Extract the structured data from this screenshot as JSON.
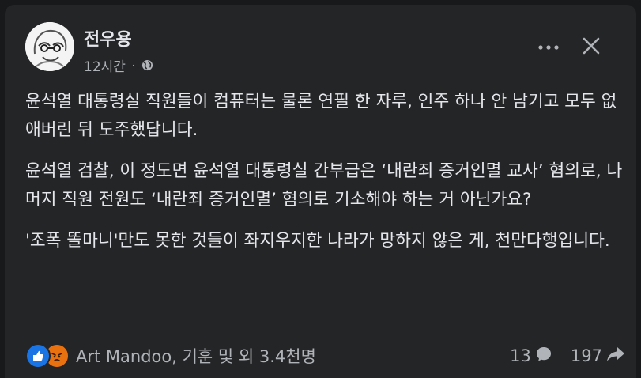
{
  "post": {
    "author": "전우용",
    "time": "12시간",
    "separator": "·",
    "paragraphs": [
      "윤석열 대통령실 직원들이 컴퓨터는 물론 연필 한 자루, 인주 하나 안 남기고 모두 없애버린 뒤 도주했답니다.",
      "윤석열 검찰, 이 정도면 윤석열 대통령실 간부급은 ‘내란죄 증거인멸 교사’ 혐의로, 나머지 직원 전원도 ‘내란죄 증거인멸’ 혐의로 기소해야 하는 거 아닌가요?",
      "'조폭 똘마니'만도 못한 것들이 좌지우지한 나라가 망하지 않은 게, 천만다행입니다."
    ]
  },
  "footer": {
    "reactors": "Art Mandoo, 기훈 및 외 3.4천명",
    "comments": "13",
    "shares": "197"
  },
  "icons": [
    "globe-icon",
    "more-icon",
    "close-icon",
    "like-icon",
    "angry-icon",
    "comment-icon",
    "share-icon"
  ],
  "colors": {
    "background": "#18191a",
    "card": "#242526",
    "text": "#e4e6eb",
    "muted": "#b0b3b8",
    "like": "#1b74e4",
    "angry": "#e9710f"
  }
}
